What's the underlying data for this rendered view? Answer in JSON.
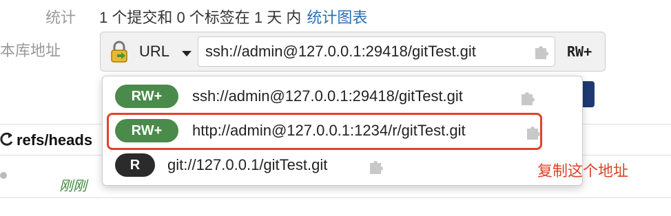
{
  "labels": {
    "stats": "统计",
    "repo_address": "版本库地址"
  },
  "stats": {
    "summary": "1 个提交和 0 个标签在 1 天 内",
    "chart_link": "统计图表"
  },
  "url_bar": {
    "protocol": "URL",
    "url": "ssh://admin@127.0.0.1:29418/gitTest.git",
    "permission": "RW+"
  },
  "dropdown": [
    {
      "badge": "RW+",
      "url": "ssh://admin@127.0.0.1:29418/gitTest.git"
    },
    {
      "badge": "RW+",
      "url": "http://admin@127.0.0.1:1234/r/gitTest.git"
    },
    {
      "badge": "R",
      "url": "git://127.0.0.1/gitTest.git"
    }
  ],
  "branch": {
    "label": "refs/heads"
  },
  "commit": {
    "time": "刚刚"
  },
  "annotation": "复制这个地址",
  "colors": {
    "badge_rw": "#4a8a4a",
    "badge_r": "#2b2b2b",
    "highlight": "#e0422b",
    "link": "#2a6fb6"
  },
  "icons": [
    "lock-icon",
    "caret-down-icon",
    "copy-puzzle-icon",
    "refresh-icon"
  ]
}
